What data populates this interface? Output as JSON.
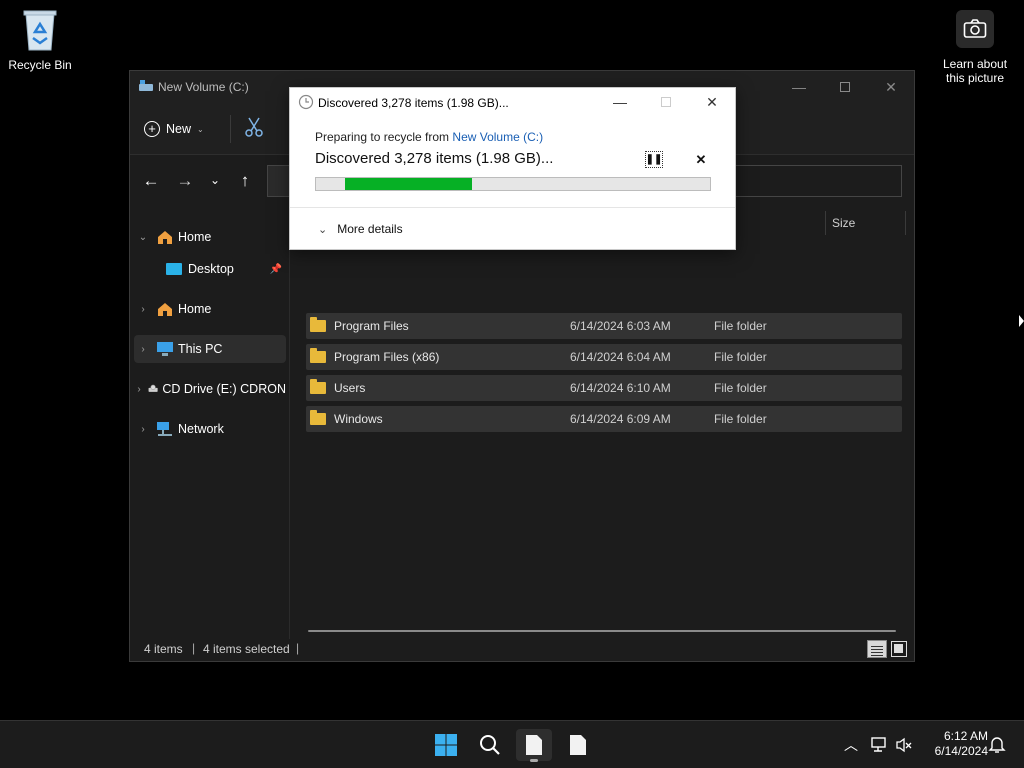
{
  "desktop": {
    "recycle_bin_label": "Recycle Bin",
    "learn_label_line1": "Learn about",
    "learn_label_line2": "this picture"
  },
  "explorer": {
    "title": "New Volume (C:)",
    "toolbar": {
      "new_label": "New"
    },
    "sidebar": [
      {
        "label": "Home",
        "icon": "home-icon",
        "expanded": true
      },
      {
        "label": "Desktop",
        "icon": "desktop-folder-icon",
        "pinned": true
      },
      {
        "label": "Home",
        "icon": "home-icon"
      },
      {
        "label": "This PC",
        "icon": "this-pc-icon",
        "selected": true
      },
      {
        "label": "CD Drive (E:) CDRON",
        "icon": "cd-drive-icon"
      },
      {
        "label": "Network",
        "icon": "network-icon"
      }
    ],
    "columns": {
      "size": "Size"
    },
    "rows": [
      {
        "name": "Program Files",
        "date": "6/14/2024 6:03 AM",
        "type": "File folder"
      },
      {
        "name": "Program Files (x86)",
        "date": "6/14/2024 6:04 AM",
        "type": "File folder"
      },
      {
        "name": "Users",
        "date": "6/14/2024 6:10 AM",
        "type": "File folder"
      },
      {
        "name": "Windows",
        "date": "6/14/2024 6:09 AM",
        "type": "File folder"
      }
    ],
    "status": {
      "items": "4 items",
      "selected": "4 items selected"
    }
  },
  "dialog": {
    "title": "Discovered 3,278 items (1.98 GB)...",
    "preparing_prefix": "Preparing to recycle from",
    "preparing_link": "New Volume (C:)",
    "heading": "Discovered 3,278 items (1.98 GB)...",
    "progress": 0.32,
    "more_details": "More details"
  },
  "taskbar": {
    "time": "6:12 AM",
    "date": "6/14/2024"
  }
}
